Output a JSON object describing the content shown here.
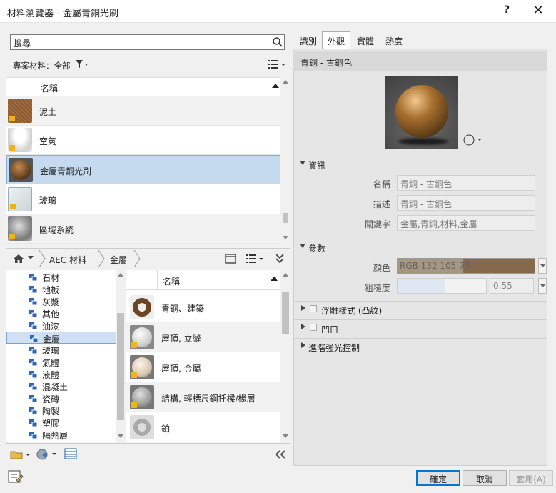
{
  "window": {
    "title": "材料瀏覽器 - 金屬青銅光刷",
    "help": "?",
    "close": "✕"
  },
  "search": {
    "value": "搜尋"
  },
  "filter": {
    "label": "專案材料：全部"
  },
  "material_list": {
    "column": "名稱",
    "items": [
      {
        "name": "泥土",
        "thumb": "dirt"
      },
      {
        "name": "空氣",
        "thumb": "air"
      },
      {
        "name": "金屬青銅光刷",
        "thumb": "bronze",
        "selected": true
      },
      {
        "name": "玻璃",
        "thumb": "glass"
      },
      {
        "name": "區域系統",
        "thumb": "system"
      }
    ]
  },
  "breadcrumb": {
    "items": [
      "AEC 材料",
      "金屬"
    ]
  },
  "library_tree": {
    "items": [
      "石材",
      "地板",
      "灰漿",
      "其他",
      "油漆",
      "金屬",
      "玻璃",
      "氣體",
      "液體",
      "混凝土",
      "瓷磚",
      "陶製",
      "塑膠",
      "隔熱層"
    ],
    "selected": "金屬"
  },
  "asset_list": {
    "column": "名稱",
    "items": [
      {
        "name": "青銅、建築",
        "thumb": "ring"
      },
      {
        "name": "屋頂, 立縫",
        "thumb": "sphere-white"
      },
      {
        "name": "屋頂, 金屬",
        "thumb": "sphere-beige"
      },
      {
        "name": "結構, 輕標尺鋼托樑/椽層",
        "thumb": "sphere-grey"
      },
      {
        "name": "鉑",
        "thumb": "ring-chrome"
      }
    ]
  },
  "tabs": [
    {
      "label": "識別",
      "active": false
    },
    {
      "label": "外觀",
      "active": true
    },
    {
      "label": "實體",
      "active": false
    },
    {
      "label": "熱度",
      "active": false
    }
  ],
  "appearance": {
    "asset_title": "青銅 - 古銅色",
    "sections": {
      "info": "資訊",
      "params": "參數",
      "relief": "浮雕樣式 (凸紋)",
      "cutout": "凹口",
      "advanced": "進階強光控制"
    },
    "info": {
      "name_label": "名稱",
      "name_value": "青銅 - 古銅色",
      "desc_label": "描述",
      "desc_value": "青銅 - 古銅色",
      "keywords_label": "關鍵字",
      "keywords_value": "金屬,青銅,材料,金屬"
    },
    "params": {
      "color_label": "顏色",
      "color_value": "RGB 132 105 75",
      "color_hex": "#84694b",
      "roughness_label": "粗糙度",
      "roughness_value": "0.55",
      "roughness_fraction": 0.55
    }
  },
  "footer": {
    "ok": "確定",
    "cancel": "取消",
    "apply": "套用(A)"
  }
}
